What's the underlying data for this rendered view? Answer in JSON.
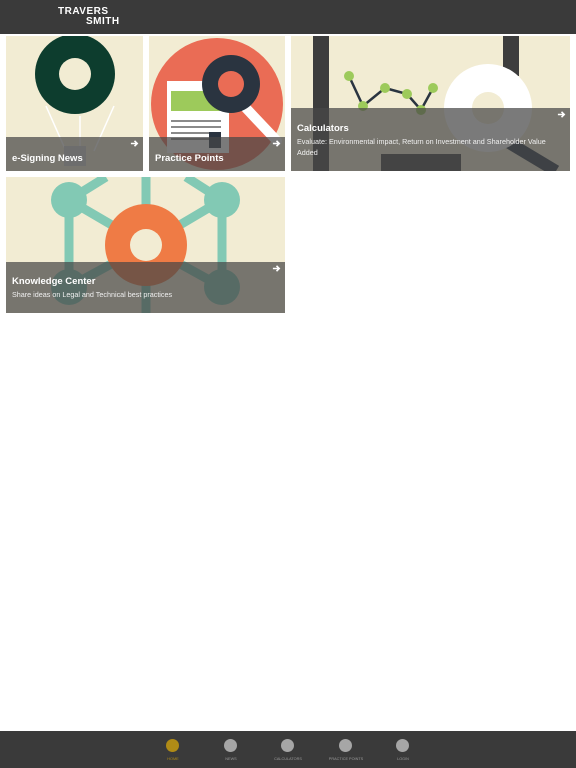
{
  "header": {
    "logo_line1": "TRAVERS",
    "logo_line2": "SMITH"
  },
  "tiles": [
    {
      "title": "e-Signing News",
      "subtitle": ""
    },
    {
      "title": "Practice Points",
      "subtitle": ""
    },
    {
      "title": "Calculators",
      "subtitle": "Evaluate: Environmental impact, Return on Investment and Shareholder Value Added"
    },
    {
      "title": "Knowledge Center",
      "subtitle": "Share ideas on Legal and Technical best practices"
    }
  ],
  "nav": {
    "items": [
      {
        "label": "HOME",
        "active": true
      },
      {
        "label": "NEWS",
        "active": false
      },
      {
        "label": "CALCULATORS",
        "active": false
      },
      {
        "label": "PRACTICE POINTS",
        "active": false
      },
      {
        "label": "LOGIN",
        "active": false
      }
    ]
  },
  "colors": {
    "header_bg": "#3a3a3a",
    "tile_bg": "#f2ecd3",
    "active_nav": "#b08b16",
    "inactive_nav": "#a6a6a6"
  }
}
